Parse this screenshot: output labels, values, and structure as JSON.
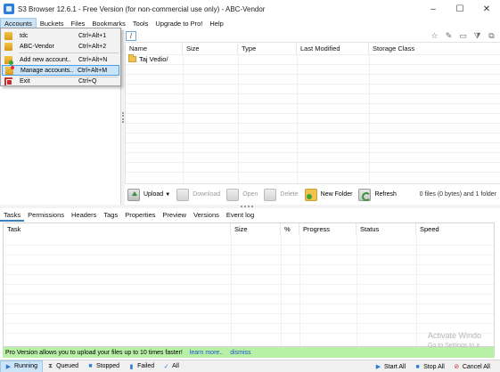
{
  "window": {
    "title": "S3 Browser 12.6.1 - Free Version (for non-commercial use only) - ABC-Vendor",
    "minimize": "–",
    "maximize": "☐",
    "close": "✕"
  },
  "menubar": [
    "Accounts",
    "Buckets",
    "Files",
    "Bookmarks",
    "Tools",
    "Upgrade to Pro!",
    "Help"
  ],
  "accounts_menu": [
    {
      "label": "tdc",
      "shortcut": "Ctrl+Alt+1",
      "icon": "bucket-icon"
    },
    {
      "label": "ABC-Vendor",
      "shortcut": "Ctrl+Alt+2",
      "icon": "bucket-icon"
    },
    {
      "label": "Add new account..",
      "shortcut": "Ctrl+Alt+N",
      "icon": "add-account-icon"
    },
    {
      "label": "Manage accounts..",
      "shortcut": "Ctrl+Alt+M",
      "icon": "manage-accounts-icon"
    },
    {
      "label": "Exit",
      "shortcut": "Ctrl+Q",
      "icon": "exit-icon"
    }
  ],
  "path": "/",
  "filelist": {
    "columns": [
      "Name",
      "Size",
      "Type",
      "Last Modified",
      "Storage Class"
    ],
    "rows": [
      {
        "name": "Taj Vedio/"
      }
    ]
  },
  "actions": {
    "upload": "Upload",
    "download": "Download",
    "open": "Open",
    "delete": "Delete",
    "new_folder": "New Folder",
    "refresh": "Refresh",
    "files_info": "0 files (0 bytes) and 1 folder"
  },
  "tabs": [
    "Tasks",
    "Permissions",
    "Headers",
    "Tags",
    "Properties",
    "Preview",
    "Versions",
    "Event log"
  ],
  "tasks": {
    "columns": [
      "Task",
      "Size",
      "%",
      "Progress",
      "Status",
      "Speed"
    ]
  },
  "pro_banner": {
    "text": "Pro Version allows you to upload your files up to 10 times faster!",
    "learn_more": "learn more..",
    "dismiss": "dismiss"
  },
  "watermark": {
    "line1": "Activate Windo",
    "line2": "Go to Settings to a"
  },
  "statusbar": {
    "running": "Running",
    "queued": "Queued",
    "stopped": "Stopped",
    "failed": "Failed",
    "all": "All",
    "start_all": "Start All",
    "stop_all": "Stop All",
    "cancel_all": "Cancel All"
  },
  "colors": {
    "accent": "#cce4f7",
    "banner": "#b8f0a8",
    "link": "#1a55c8"
  }
}
